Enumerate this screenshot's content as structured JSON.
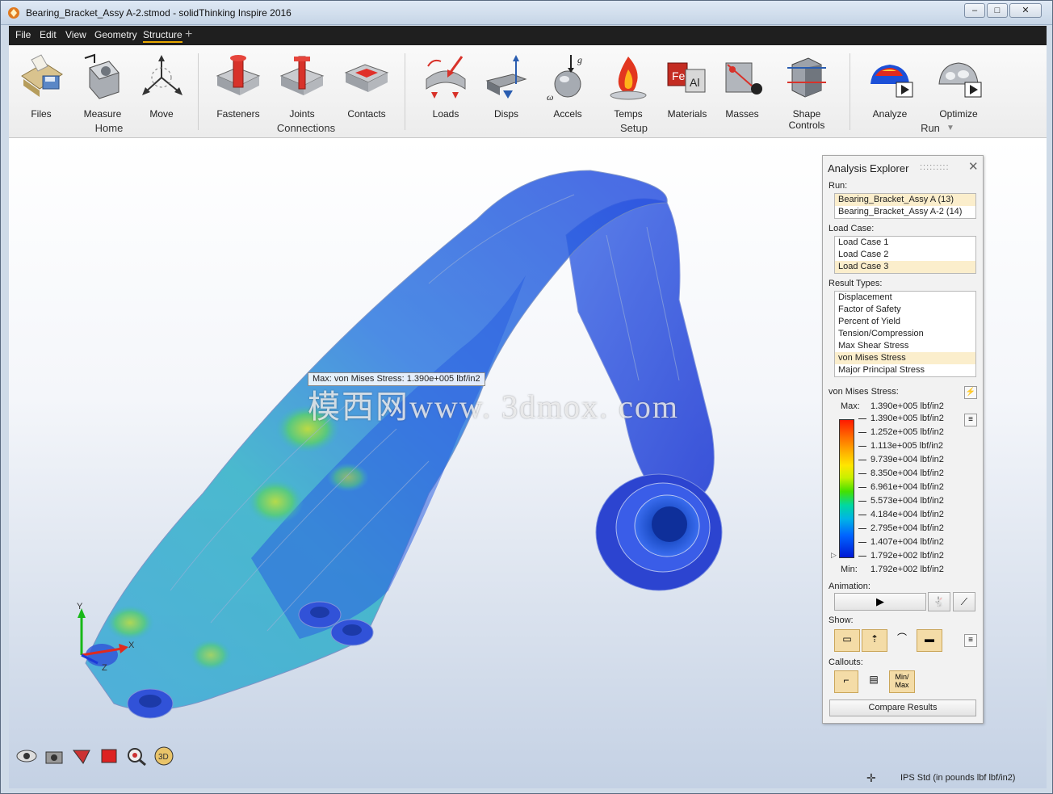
{
  "window": {
    "title": "Bearing_Bracket_Assy A-2.stmod - solidThinking Inspire 2016",
    "controls": {
      "minimize": "–",
      "restore": "□",
      "close": "✕"
    }
  },
  "menu": [
    "File",
    "Edit",
    "View",
    "Geometry",
    "Structure"
  ],
  "menu_add": "+",
  "ribbon": {
    "tools": [
      {
        "label": "Files",
        "icon": "files-icon"
      },
      {
        "label": "Measure",
        "icon": "measure-icon"
      },
      {
        "label": "Move",
        "icon": "move-icon"
      },
      {
        "label": "Fasteners",
        "icon": "fasteners-icon"
      },
      {
        "label": "Joints",
        "icon": "joints-icon"
      },
      {
        "label": "Contacts",
        "icon": "contacts-icon"
      },
      {
        "label": "Loads",
        "icon": "loads-icon"
      },
      {
        "label": "Disps",
        "icon": "disps-icon"
      },
      {
        "label": "Accels",
        "icon": "accels-icon"
      },
      {
        "label": "Temps",
        "icon": "temps-icon"
      },
      {
        "label": "Materials",
        "icon": "materials-icon"
      },
      {
        "label": "Masses",
        "icon": "masses-icon"
      },
      {
        "label": "Shape Controls",
        "icon": "shape-controls-icon"
      },
      {
        "label": "Analyze",
        "icon": "analyze-icon"
      },
      {
        "label": "Optimize",
        "icon": "optimize-icon"
      }
    ],
    "groups": [
      "Home",
      "Connections",
      "Setup",
      "Run"
    ],
    "run_arrow": "▼"
  },
  "viewport": {
    "callout": "Max: von Mises Stress: 1.390e+005 lbf/in2",
    "watermark": "模西网www. 3dmox. com",
    "units": "IPS Std (in pounds lbf lbf/in2)",
    "triad_labels": {
      "y": "Y",
      "z": "Z",
      "x": "X"
    }
  },
  "analysis_explorer": {
    "title": "Analysis Explorer",
    "grip": ":::::::::",
    "close": "✕",
    "run_label": "Run:",
    "runs": [
      "Bearing_Bracket_Assy A (13)",
      "Bearing_Bracket_Assy A-2 (14)"
    ],
    "run_selected": 0,
    "load_case_label": "Load Case:",
    "load_cases": [
      "Load Case 1",
      "Load Case 2",
      "Load Case 3"
    ],
    "load_case_selected": 2,
    "result_types_label": "Result Types:",
    "result_types": [
      "Displacement",
      "Factor of Safety",
      "Percent of Yield",
      "Tension/Compression",
      "Max Shear Stress",
      "von Mises Stress",
      "Major Principal Stress"
    ],
    "result_type_selected": 5,
    "legend_title": "von Mises Stress:",
    "max_label": "Max:",
    "max_value": "1.390e+005 lbf/in2",
    "min_label": "Min:",
    "min_value": "1.792e+002 lbf/in2",
    "ticks": [
      "1.390e+005 lbf/in2",
      "1.252e+005 lbf/in2",
      "1.113e+005 lbf/in2",
      "9.739e+004 lbf/in2",
      "8.350e+004 lbf/in2",
      "6.961e+004 lbf/in2",
      "5.573e+004 lbf/in2",
      "4.184e+004 lbf/in2",
      "2.795e+004 lbf/in2",
      "1.407e+004 lbf/in2",
      "1.792e+002 lbf/in2"
    ],
    "animation_label": "Animation:",
    "play": "▶",
    "show_label": "Show:",
    "callouts_label": "Callouts:",
    "minmax_button": "Min/ Max",
    "compare_button": "Compare Results",
    "menu_glyph": "≡",
    "flash_glyph": "⚡"
  }
}
